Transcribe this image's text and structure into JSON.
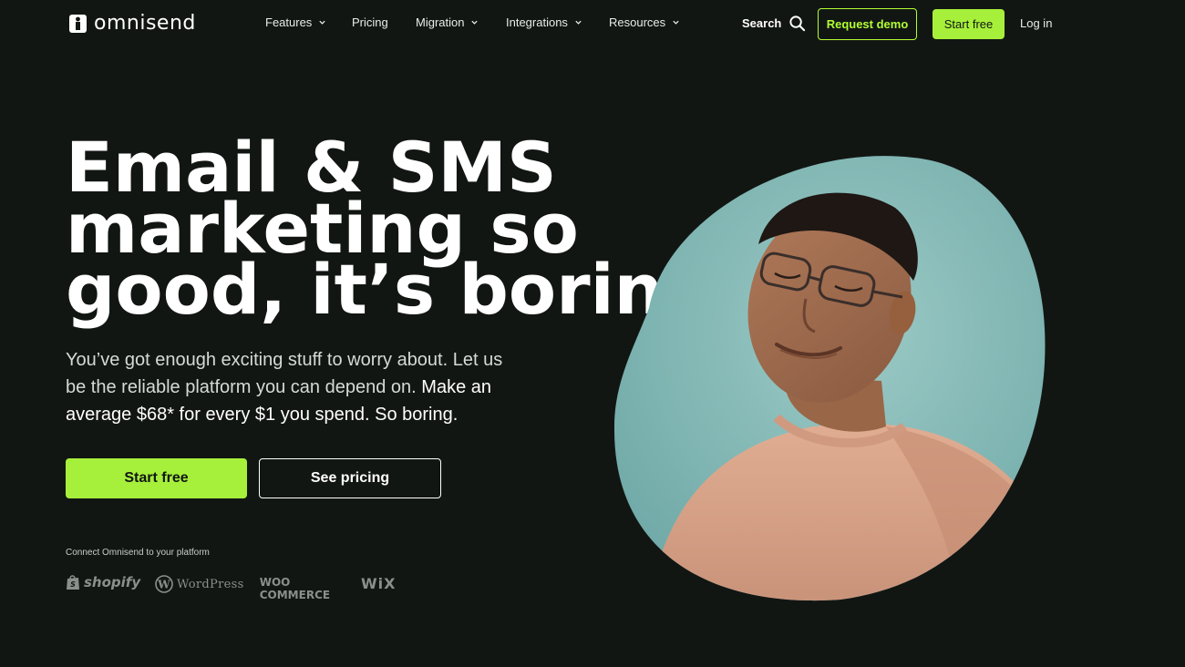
{
  "nav": {
    "logo_text": "omnisend",
    "items": [
      {
        "label": "Features",
        "has_dropdown": true
      },
      {
        "label": "Pricing",
        "has_dropdown": false
      },
      {
        "label": "Migration",
        "has_dropdown": true
      },
      {
        "label": "Integrations",
        "has_dropdown": true
      },
      {
        "label": "Resources",
        "has_dropdown": true
      }
    ],
    "search_label": "Search",
    "request_demo_label": "Request demo",
    "start_free_label": "Start free",
    "login_label": "Log in"
  },
  "hero": {
    "headline_lines": [
      "Email & SMS",
      "marketing so",
      "good, it’s boring"
    ],
    "subtext_plain": "You’ve got enough exciting stuff to worry about. Let us be the reliable platform you can depend on.",
    "subtext_strong": "Make an average $68* for every $1 you spend. So boring.",
    "primary_cta": "Start free",
    "secondary_cta": "See pricing",
    "connect_label": "Connect Omnisend to your platform",
    "platforms": [
      "shopify",
      "WordPress",
      "WOO COMMERCE",
      "WiX"
    ]
  },
  "colors": {
    "background": "#121613",
    "accent": "#a6f03b",
    "accent_border": "#b2ff32",
    "text": "#ffffff",
    "image_bg": "#7fb8b6",
    "sweater": "#d9a488"
  },
  "icons": {
    "search": "search-icon",
    "dropdown": "chevron-down-icon",
    "logo": "omnisend-logo-icon"
  }
}
